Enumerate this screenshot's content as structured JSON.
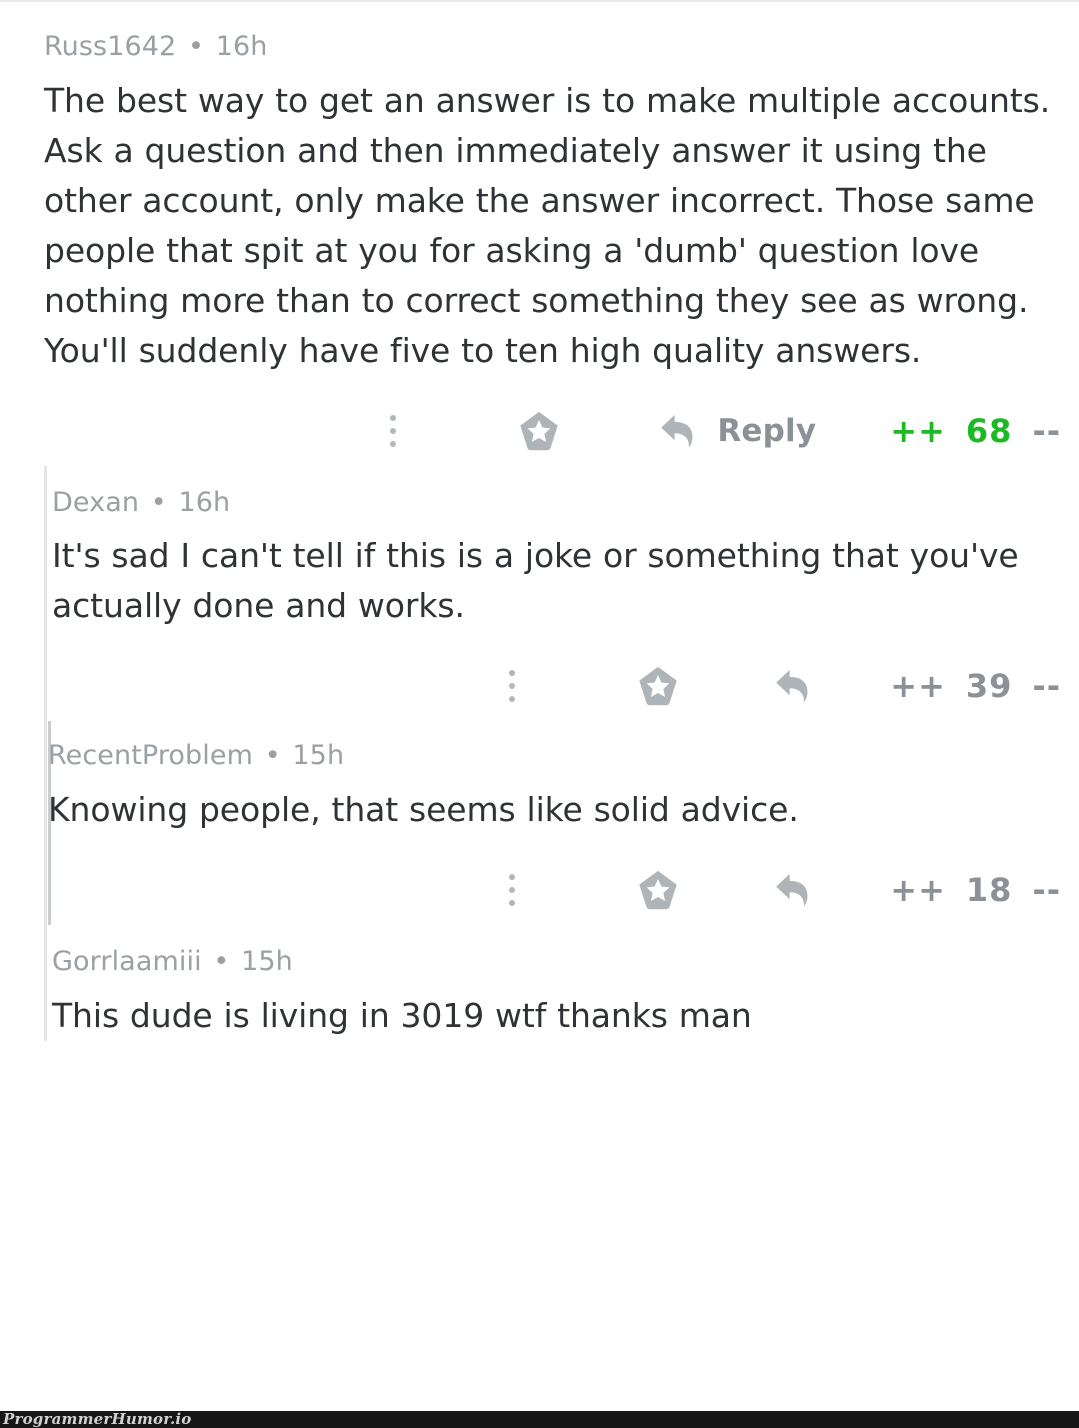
{
  "watermark": {
    "label": "ProgrammerHumor.io"
  },
  "separator": "•",
  "actions": {
    "more_icon": "vertical-dots-icon",
    "award_icon": "award-pentagon-star-icon",
    "reply_icon": "reply-arrow-icon",
    "reply_label": "Reply",
    "upvote_label": "++",
    "downvote_label": "--"
  },
  "colors": {
    "upvoted": "#1db924",
    "muted": "#8b9197",
    "byline": "#9aa0a4",
    "body": "#2f3336",
    "thread_line": "#e4e6e8",
    "thread_line_deep": "#c9cdd0",
    "watermark_bg": "#161616",
    "watermark_fg": "#d2d2d2"
  },
  "comments": [
    {
      "author": "Russ1642",
      "age": "16h",
      "depth": 0,
      "text": "The best way to get an answer is to make multiple accounts. Ask a question and then immediately answer it using the other account, only make the answer incorrect. Those same people that spit at you for asking a 'dumb' question love nothing more than to correct something they see as wrong. You'll suddenly have five to ten high quality answers.",
      "score": "68",
      "upvoted": true,
      "show_reply_label": true
    },
    {
      "author": "Dexan",
      "age": "16h",
      "depth": 1,
      "text": "It's sad I can't tell if this is a joke or something that you've actually done and works.",
      "score": "39",
      "upvoted": false,
      "show_reply_label": false
    },
    {
      "author": "RecentProblem",
      "age": "15h",
      "depth": 2,
      "text": "Knowing people, that seems like solid advice.",
      "score": "18",
      "upvoted": false,
      "show_reply_label": false
    },
    {
      "author": "Gorrlaamiii",
      "age": "15h",
      "depth": 1,
      "text": "This dude is living in 3019 wtf thanks man",
      "score": "",
      "upvoted": false,
      "show_reply_label": false
    }
  ]
}
